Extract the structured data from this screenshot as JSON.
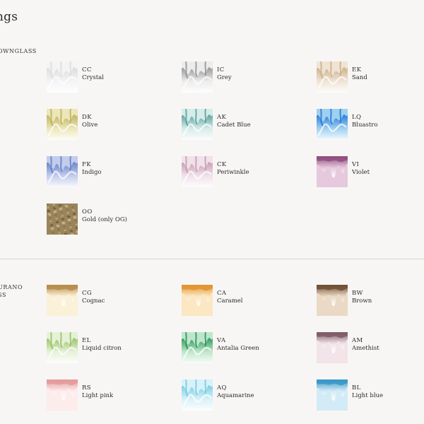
{
  "header": {
    "title": "ngs"
  },
  "sections": [
    {
      "label": "OWNGLASS",
      "swatches": [
        {
          "code": "CC",
          "name": "Crystal",
          "color": "#d9d9db",
          "tint": "#f4f4f5",
          "type": "flow"
        },
        {
          "code": "IC",
          "name": "Grey",
          "color": "#8c8c8c",
          "tint": "#ececec",
          "type": "flow"
        },
        {
          "code": "EK",
          "name": "Sand",
          "color": "#c8aa82",
          "tint": "#efe4d4",
          "type": "flow"
        },
        {
          "code": "DK",
          "name": "Olive",
          "color": "#b9ad56",
          "tint": "#ece6b8",
          "type": "flow"
        },
        {
          "code": "AK",
          "name": "Cadet Blue",
          "color": "#4f9a96",
          "tint": "#d6ecea",
          "type": "flow"
        },
        {
          "code": "LQ",
          "name": "Bluastro",
          "color": "#1c72d8",
          "tint": "#9fd0ef",
          "type": "flow"
        },
        {
          "code": "FK",
          "name": "Indigo",
          "color": "#5e78c7",
          "tint": "#c3cdeb",
          "type": "flow"
        },
        {
          "code": "CK",
          "name": "Periwinkle",
          "color": "#c495ad",
          "tint": "#f0e2ea",
          "type": "flow"
        },
        {
          "code": "VI",
          "name": "Violet",
          "color": "#8f4f7f",
          "tint": "#e6c9dc",
          "type": "drip"
        },
        {
          "code": "OO",
          "name": "Gold (only OG)",
          "color": "#9a845a",
          "tint": "#c8b58c",
          "type": "texture"
        }
      ]
    },
    {
      "label": "URANO\nSS",
      "swatches": [
        {
          "code": "CG",
          "name": "Cognac",
          "color": "#b8894a",
          "tint": "#fbf1d8",
          "type": "drip"
        },
        {
          "code": "CA",
          "name": "Caramel",
          "color": "#e39330",
          "tint": "#fbe7c2",
          "type": "drip"
        },
        {
          "code": "BW",
          "name": "Brown",
          "color": "#6f5034",
          "tint": "#ead9c4",
          "type": "drip"
        },
        {
          "code": "EL",
          "name": "Liquid citron",
          "color": "#8fbf5a",
          "tint": "#e6f1d8",
          "type": "flow"
        },
        {
          "code": "VA",
          "name": "Antalia Green",
          "color": "#1f8f4c",
          "tint": "#bfe6cc",
          "type": "flow"
        },
        {
          "code": "AM",
          "name": "Amethist",
          "color": "#7e5a67",
          "tint": "#f2e4e8",
          "type": "drip"
        },
        {
          "code": "RS",
          "name": "Light pink",
          "color": "#e49a9a",
          "tint": "#fdecec",
          "type": "drip"
        },
        {
          "code": "AQ",
          "name": "Aquamarine",
          "color": "#6ccbe0",
          "tint": "#d9f1f8",
          "type": "flow"
        },
        {
          "code": "BL",
          "name": "Light blue",
          "color": "#3a96c8",
          "tint": "#d3ebf6",
          "type": "drip"
        }
      ]
    }
  ]
}
